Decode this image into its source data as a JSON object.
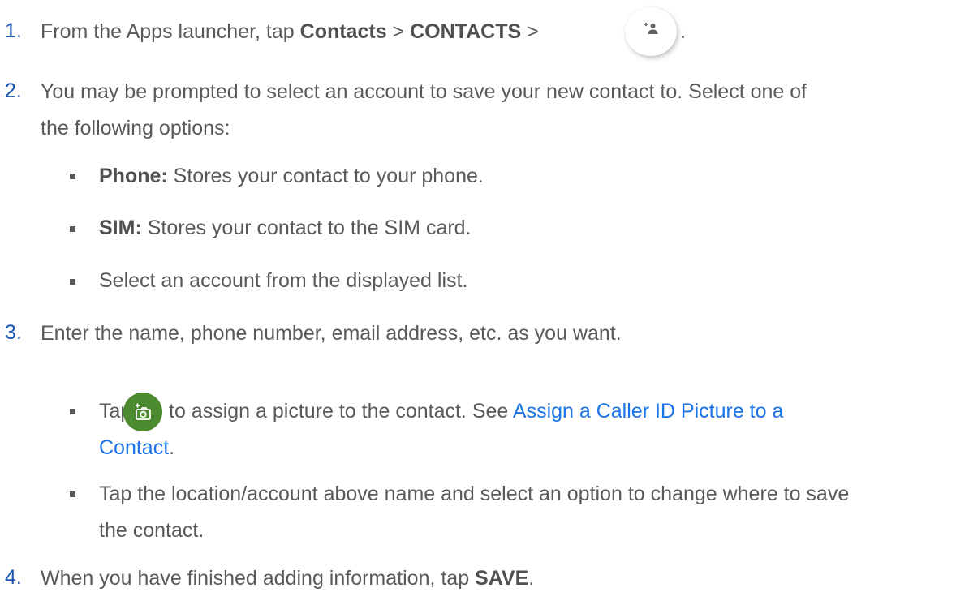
{
  "steps": [
    {
      "number": "1.",
      "pre": "From the Apps launcher, tap ",
      "bold1": "Contacts",
      "sep1": " > ",
      "bold2": "CONTACTS",
      "sep2": " > ",
      "end": ".",
      "icon": "add-contact-icon"
    },
    {
      "number": "2.",
      "line1": "You may be prompted to select an account to save your new contact to. Select one of",
      "line2": "the following options:",
      "bullets": [
        {
          "bold": "Phone:",
          "text": " Stores your contact to your phone."
        },
        {
          "bold": "SIM:",
          "text": " Stores your contact to the SIM card."
        },
        {
          "bold": "",
          "text": "Select an account from the displayed list."
        }
      ]
    },
    {
      "number": "3.",
      "line1": "Enter the name, phone number, email address, etc. as you want.",
      "bullets": [
        {
          "pre": "Tap ",
          "icon": "add-photo-icon",
          "post": " to assign a picture to the contact. See ",
          "link_line1": "Assign a Caller ID Picture to a",
          "link_line2": "Contact",
          "end": "."
        },
        {
          "line1": "Tap the location/account above name and select an option to change where to save",
          "line2": "the contact."
        }
      ]
    },
    {
      "number": "4.",
      "pre": "When you have finished adding information, tap ",
      "bold": "SAVE",
      "end": "."
    }
  ],
  "colors": {
    "text": "#595959",
    "number": "#1a56b0",
    "link": "#1a73e8",
    "icon_green": "#4b8a2e"
  }
}
